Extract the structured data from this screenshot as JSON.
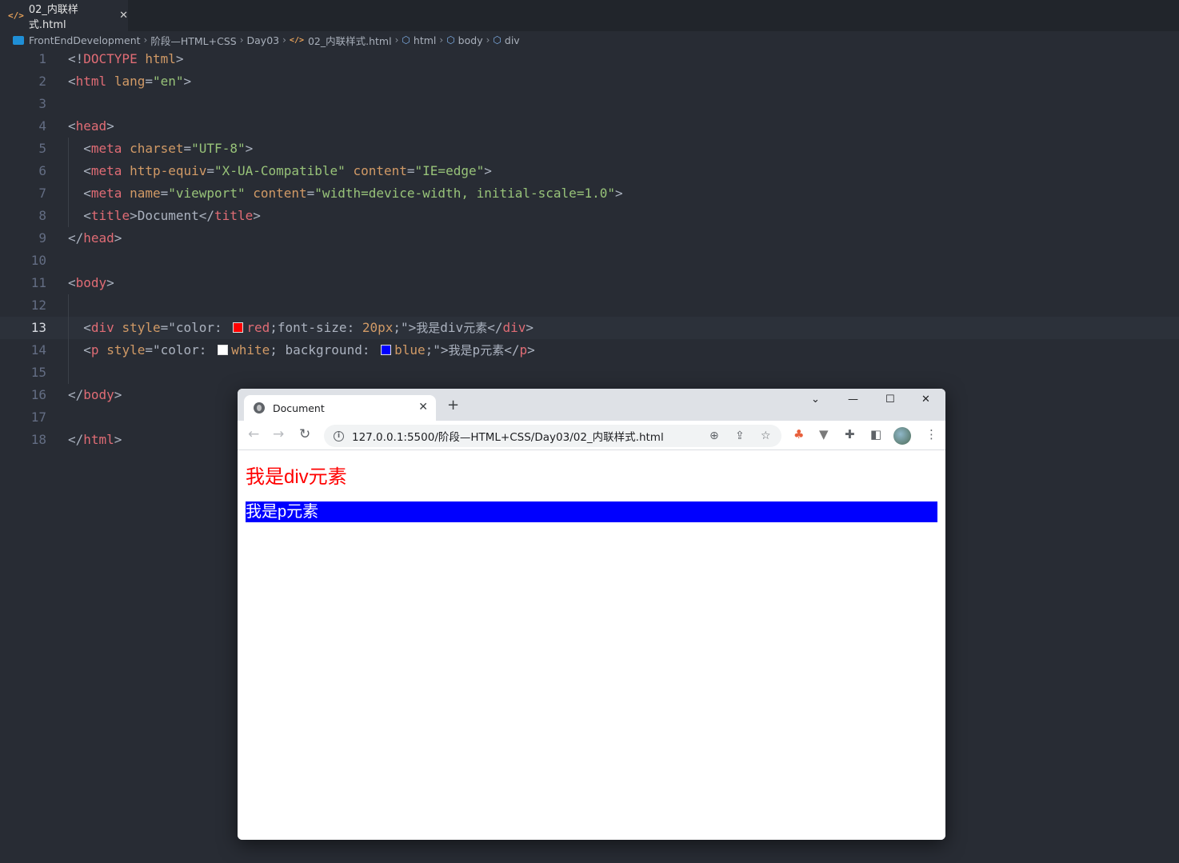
{
  "editor": {
    "tab": {
      "name": "02_内联样式.html",
      "icon": "html-file-icon"
    },
    "breadcrumbs": [
      "FrontEndDevelopment",
      "阶段—HTML+CSS",
      "Day03",
      "02_内联样式.html",
      "html",
      "body",
      "div"
    ],
    "current_line": 13,
    "line_numbers": [
      "1",
      "2",
      "3",
      "4",
      "5",
      "6",
      "7",
      "8",
      "9",
      "10",
      "11",
      "12",
      "13",
      "14",
      "15",
      "16",
      "17",
      "18"
    ]
  },
  "browser": {
    "tab_title": "Document",
    "url": "127.0.0.1:5500/阶段—HTML+CSS/Day03/02_内联样式.html",
    "content": {
      "div_text": "我是div元素",
      "p_text": "我是p元素"
    }
  },
  "colors": {
    "editor_bg": "#282c34",
    "tag": "#e06c75",
    "attribute": "#d19a66",
    "string": "#98c379",
    "div_text_color": "#ff0000",
    "p_background": "#0000ff",
    "p_text_color": "#ffffff"
  }
}
